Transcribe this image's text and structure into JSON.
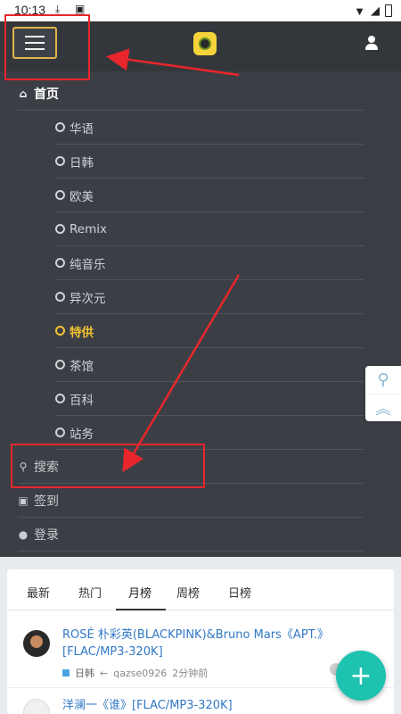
{
  "status_bar": {
    "time": "10:13"
  },
  "header": {
    "logo_icon": "app-logo",
    "user_icon": "user-icon"
  },
  "nav": {
    "home": "首页",
    "sub_items": [
      "华语",
      "日韩",
      "欧美",
      "Remix",
      "纯音乐",
      "异次元",
      "特供",
      "茶馆",
      "百科",
      "站务"
    ],
    "active_item": "特供",
    "search": "搜索",
    "checkin": "签到",
    "login": "登录"
  },
  "tabs": [
    "最新",
    "热门",
    "月榜",
    "周榜",
    "日榜"
  ],
  "active_tab": "月榜",
  "posts": [
    {
      "title": "ROSÉ 朴彩英(BLACKPINK)&Bruno Mars《APT.》[FLAC/MP3-320K]",
      "category": "日韩",
      "author": "qazse0926",
      "time": "2分钟前"
    },
    {
      "title": "洋澜一《谁》[FLAC/MP3-320K]"
    }
  ],
  "colors": {
    "accent": "#f1c232",
    "highlight_box": "#e8262b",
    "fab": "#1ec3b0",
    "link": "#3178c6"
  }
}
